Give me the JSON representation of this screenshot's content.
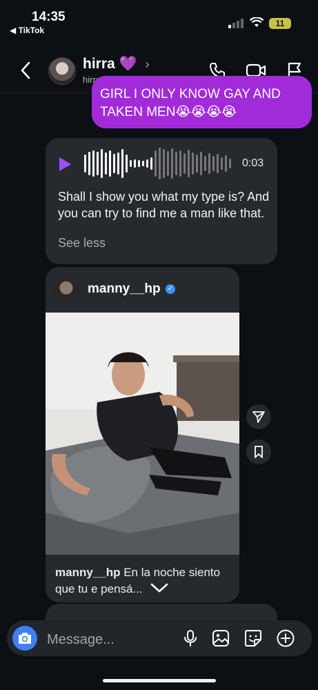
{
  "status_bar": {
    "time": "14:35",
    "back_app": "◀ TikTok",
    "battery": "11"
  },
  "header": {
    "name": "hirra 💜",
    "chevron": "›",
    "username": "hirrahohoho4lyfe"
  },
  "messages": {
    "outgoing_text": "GIRL I ONLY KNOW GAY AND TAKEN MEN😭😭😭😭",
    "audio": {
      "duration": "0:03",
      "transcript": "Shall I show you what my type is? And you can try to find me a man like that.",
      "see_less": "See less"
    },
    "shared_post": {
      "username": "manny__hp",
      "caption_user": "manny__hp",
      "caption_text": " En la noche siento que tu e    pensá..."
    }
  },
  "composer": {
    "placeholder": "Message..."
  },
  "colors": {
    "accent": "#a12bd8",
    "camera": "#3f7ff3",
    "verified": "#3b95ef",
    "bubble": "#262a2f"
  },
  "icons": [
    "phone-icon",
    "video-icon",
    "flag-icon",
    "camera-icon",
    "mic-icon",
    "gallery-icon",
    "sticker-icon",
    "plus-icon",
    "send-icon",
    "bookmark-icon",
    "chevron-down-icon"
  ]
}
